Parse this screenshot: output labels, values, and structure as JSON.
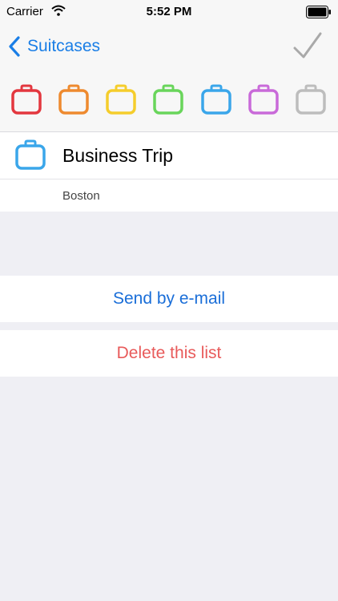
{
  "status_bar": {
    "carrier": "Carrier",
    "time": "5:52 PM"
  },
  "nav": {
    "back_label": "Suitcases",
    "done_icon": "checkmark-icon"
  },
  "colors": {
    "accent": "#1a7ee6",
    "destructive": "#e85a5a"
  },
  "suitcase_colors": [
    {
      "name": "red",
      "hex": "#e3373f"
    },
    {
      "name": "orange",
      "hex": "#ee8a2f"
    },
    {
      "name": "yellow",
      "hex": "#f5cd2c"
    },
    {
      "name": "green",
      "hex": "#69d55b"
    },
    {
      "name": "blue",
      "hex": "#3aa6ea"
    },
    {
      "name": "purple",
      "hex": "#c96ad9"
    },
    {
      "name": "gray",
      "hex": "#bdbdbd"
    }
  ],
  "list": {
    "title": "Business Trip",
    "subtitle": "Boston",
    "selected_color": "blue",
    "icon": "suitcase-icon"
  },
  "actions": {
    "send": "Send by e-mail",
    "delete": "Delete this list"
  }
}
